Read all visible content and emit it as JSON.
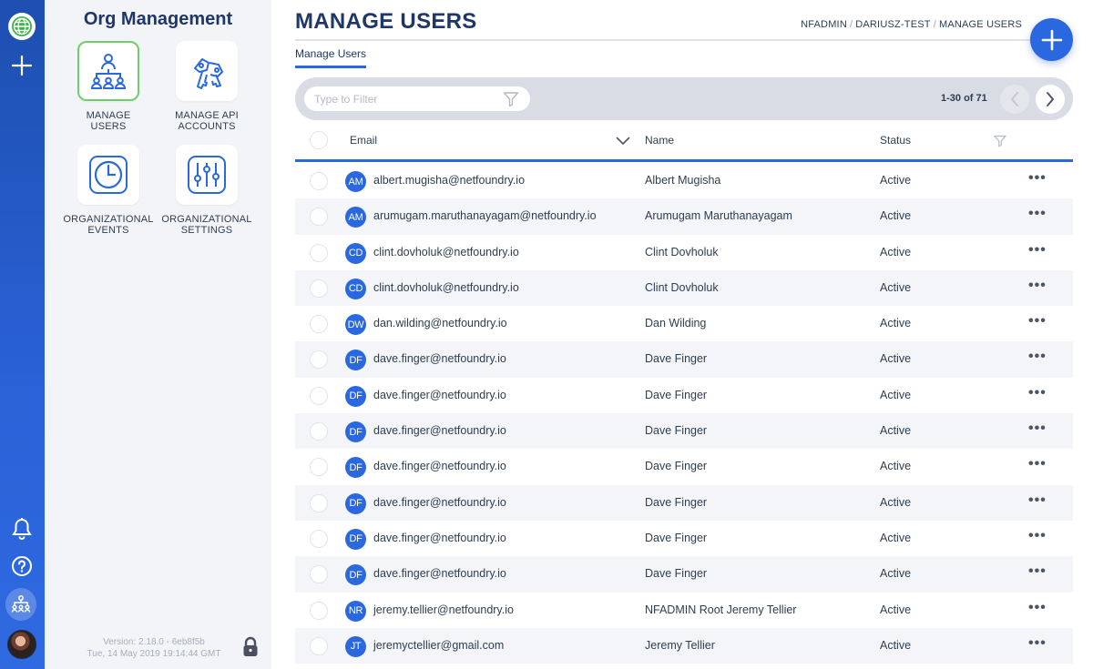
{
  "sidebar_panel": {
    "title": "Org Management",
    "tiles": [
      {
        "label_line1": "MANAGE",
        "label_line2": "USERS",
        "icon": "org-chart-icon",
        "active": true
      },
      {
        "label_line1": "MANAGE API",
        "label_line2": "ACCOUNTS",
        "icon": "keys-icon",
        "active": false
      },
      {
        "label_line1": "ORGANIZATIONAL",
        "label_line2": "EVENTS",
        "icon": "clock-icon",
        "active": false
      },
      {
        "label_line1": "ORGANIZATIONAL",
        "label_line2": "SETTINGS",
        "icon": "sliders-icon",
        "active": false
      }
    ],
    "version": "Version: 2.18.0 - 6eb8f5b",
    "build_date": "Tue, 14 May 2019 19:14:44 GMT"
  },
  "header": {
    "title": "MANAGE USERS",
    "breadcrumb": [
      "NFADMIN",
      "DARIUSZ-TEST",
      "MANAGE USERS"
    ],
    "breadcrumb_sep": "/"
  },
  "tabs": [
    {
      "label": "Manage Users"
    }
  ],
  "filter": {
    "placeholder": "Type to Filter",
    "value": ""
  },
  "pagination": {
    "range": "1-30 of 71"
  },
  "table": {
    "columns": {
      "email": "Email",
      "name": "Name",
      "status": "Status"
    },
    "rows": [
      {
        "initials": "AM",
        "email": "albert.mugisha@netfoundry.io",
        "name": "Albert Mugisha",
        "status": "Active"
      },
      {
        "initials": "AM",
        "email": "arumugam.maruthanayagam@netfoundry.io",
        "name": "Arumugam Maruthanayagam",
        "status": "Active"
      },
      {
        "initials": "CD",
        "email": "clint.dovholuk@netfoundry.io",
        "name": "Clint Dovholuk",
        "status": "Active"
      },
      {
        "initials": "CD",
        "email": "clint.dovholuk@netfoundry.io",
        "name": "Clint Dovholuk",
        "status": "Active"
      },
      {
        "initials": "DW",
        "email": "dan.wilding@netfoundry.io",
        "name": "Dan Wilding",
        "status": "Active"
      },
      {
        "initials": "DF",
        "email": "dave.finger@netfoundry.io",
        "name": "Dave Finger",
        "status": "Active"
      },
      {
        "initials": "DF",
        "email": "dave.finger@netfoundry.io",
        "name": "Dave Finger",
        "status": "Active"
      },
      {
        "initials": "DF",
        "email": "dave.finger@netfoundry.io",
        "name": "Dave Finger",
        "status": "Active"
      },
      {
        "initials": "DF",
        "email": "dave.finger@netfoundry.io",
        "name": "Dave Finger",
        "status": "Active"
      },
      {
        "initials": "DF",
        "email": "dave.finger@netfoundry.io",
        "name": "Dave Finger",
        "status": "Active"
      },
      {
        "initials": "DF",
        "email": "dave.finger@netfoundry.io",
        "name": "Dave Finger",
        "status": "Active"
      },
      {
        "initials": "DF",
        "email": "dave.finger@netfoundry.io",
        "name": "Dave Finger",
        "status": "Active"
      },
      {
        "initials": "NR",
        "email": "jeremy.tellier@netfoundry.io",
        "name": "NFADMIN Root Jeremy Tellier",
        "status": "Active"
      },
      {
        "initials": "JT",
        "email": "jeremyctellier@gmail.com",
        "name": "Jeremy Tellier",
        "status": "Active"
      }
    ],
    "row_menu_glyph": "•••"
  },
  "colors": {
    "accent": "#2a68e0",
    "title": "#1f3668",
    "active_tile_border": "#6fd06a",
    "globe_green": "#3cb34a"
  }
}
